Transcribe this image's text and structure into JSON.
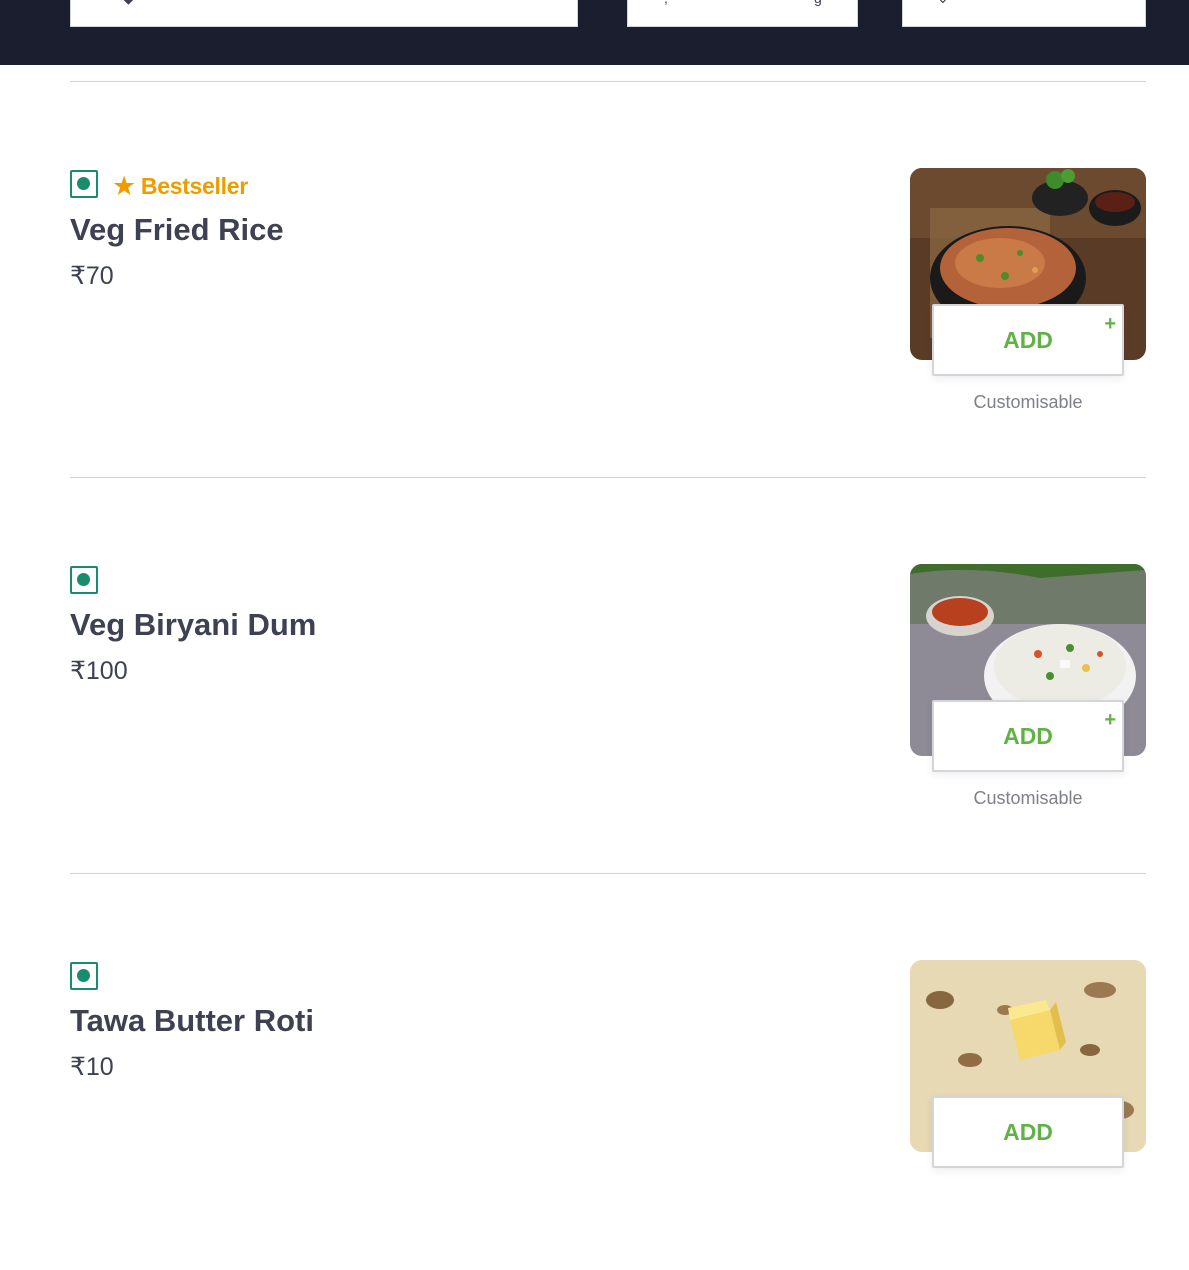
{
  "colors": {
    "header_bg": "#1b1e2e",
    "veg_green": "#1a8c6e",
    "bestseller_orange": "#ee9c00",
    "add_green": "#60b246",
    "text_dark": "#3d4152",
    "text_muted": "#7e808c"
  },
  "header": {
    "search_icon": "search-icon",
    "filter_icon": "filter-icon",
    "sort_icon": "sort-icon"
  },
  "menu": {
    "items": [
      {
        "veg": true,
        "badge": "Bestseller",
        "badge_icon": "star-icon",
        "name": "Veg Fried Rice",
        "price": "₹70",
        "add_label": "ADD",
        "plus": "+",
        "note": "Customisable"
      },
      {
        "veg": true,
        "badge": "",
        "name": "Veg Biryani Dum",
        "price": "₹100",
        "add_label": "ADD",
        "plus": "+",
        "note": "Customisable"
      },
      {
        "veg": true,
        "badge": "",
        "name": "Tawa Butter Roti",
        "price": "₹10",
        "add_label": "ADD",
        "plus": "",
        "note": ""
      }
    ]
  }
}
